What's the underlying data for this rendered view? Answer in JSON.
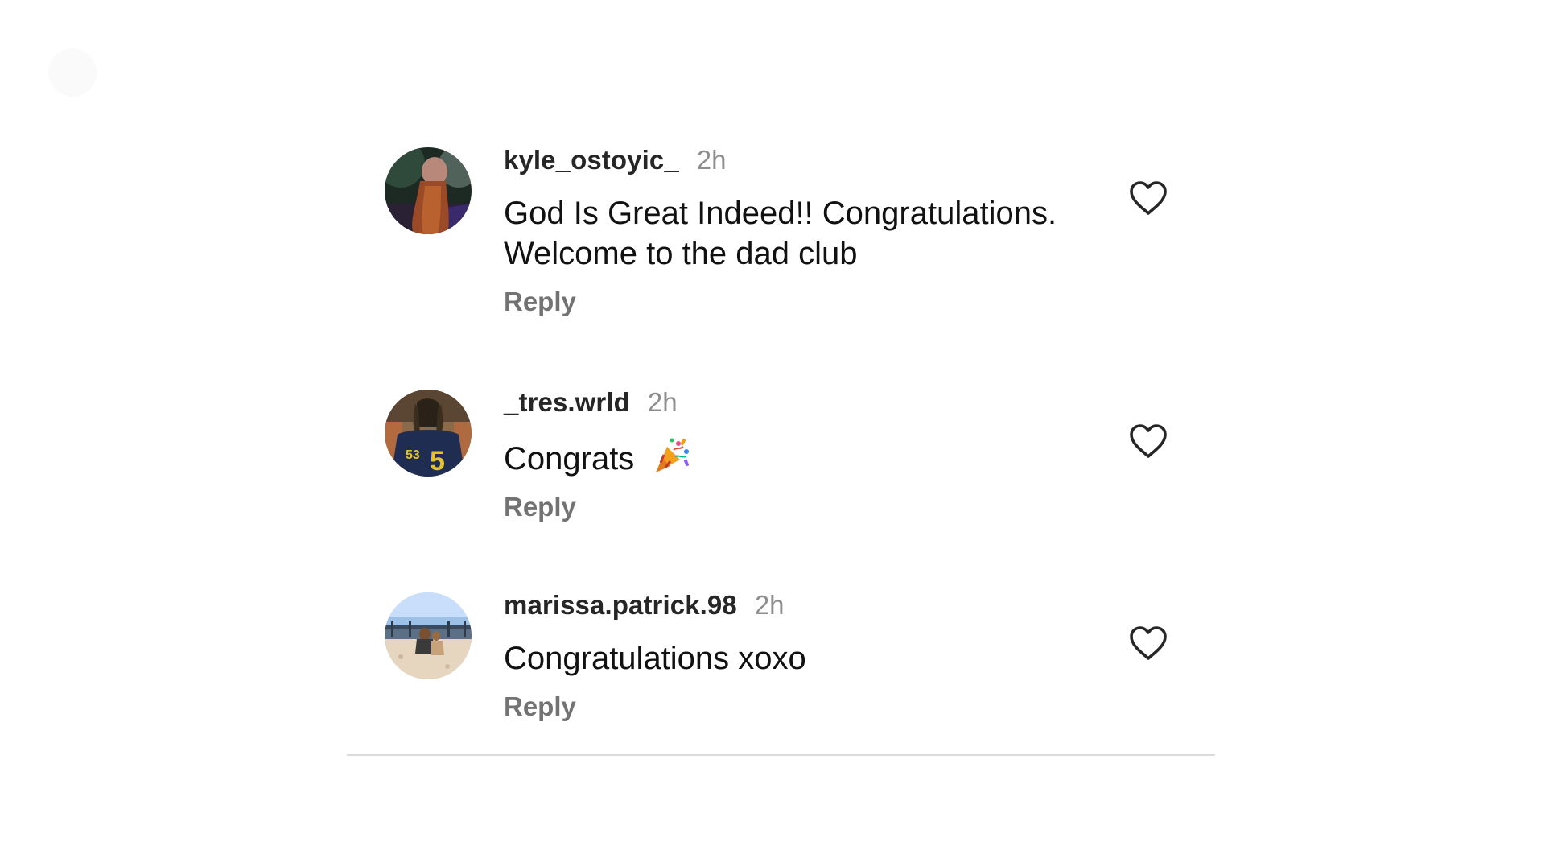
{
  "comments": [
    {
      "username": "kyle_ostoyic_",
      "time": "2h",
      "text_lines": [
        "God Is Great Indeed!! Congratulations.",
        "Welcome to the dad club"
      ],
      "reply_label": "Reply"
    },
    {
      "username": "_tres.wrld",
      "time": "2h",
      "text": "Congrats",
      "emoji": "party-popper",
      "reply_label": "Reply"
    },
    {
      "username": "marissa.patrick.98",
      "time": "2h",
      "text": "Congratulations xoxo",
      "reply_label": "Reply"
    }
  ],
  "icons": {
    "like": "heart-outline-icon",
    "celebration": "party-popper-icon"
  },
  "colors": {
    "username": "#262626",
    "timestamp": "#8e8e8e",
    "reply": "#737373",
    "divider": "#dbdbdb"
  }
}
